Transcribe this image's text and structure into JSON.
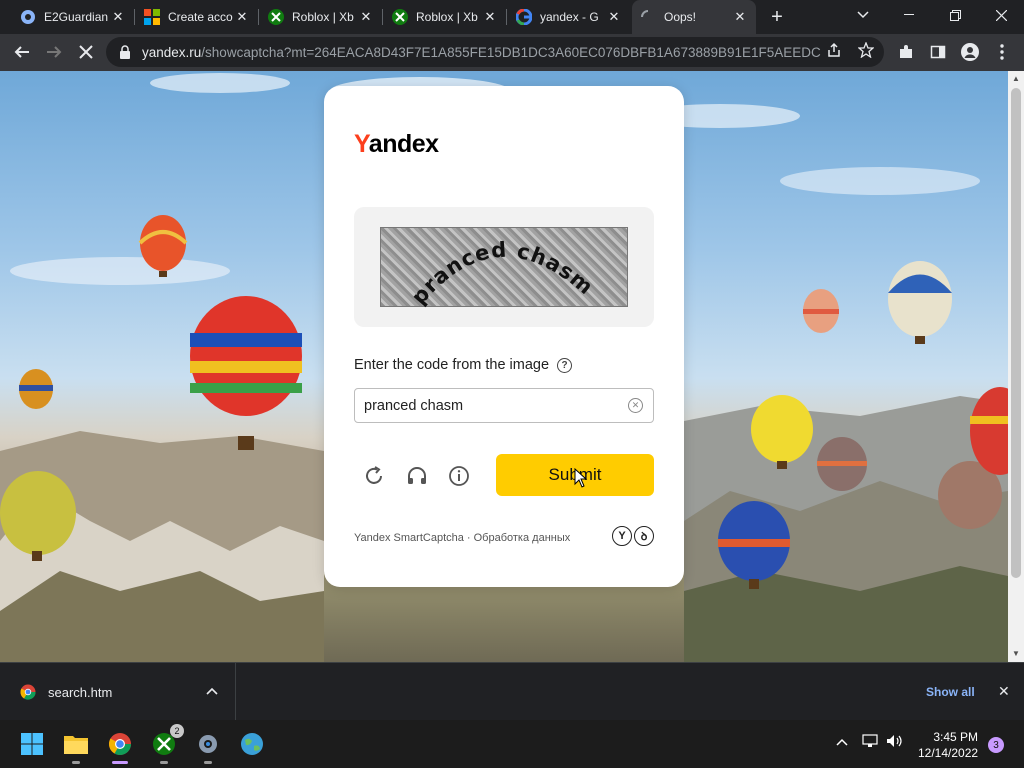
{
  "browser": {
    "tabs": [
      {
        "title": "E2Guardian",
        "favicon": "globe-icon"
      },
      {
        "title": "Create acco",
        "favicon": "microsoft-logo-icon"
      },
      {
        "title": "Roblox | Xb",
        "favicon": "xbox-icon"
      },
      {
        "title": "Roblox | Xb",
        "favicon": "xbox-icon"
      },
      {
        "title": "yandex - G",
        "favicon": "google-icon"
      },
      {
        "title": "Oops!",
        "favicon": "loading-spinner-icon",
        "active": true
      }
    ],
    "url_host": "yandex.ru",
    "url_path": "/showcaptcha?mt=264EACA8D43F7E1A855FE15DB1DC3A60EC076DBFB1A673889B91E1F5AEEDC..."
  },
  "captcha": {
    "logo_first": "Y",
    "logo_rest": "andex",
    "image_text": "pranced chasm",
    "prompt": "Enter the code from the image",
    "help": "?",
    "input_value": "pranced chasm",
    "submit_label": "Submit",
    "footer": "Yandex SmartCaptcha · Обработка данных",
    "footer_logo_1": "Y",
    "footer_logo_2": "ꝺ"
  },
  "downloads": {
    "file_name": "search.htm",
    "show_all": "Show all"
  },
  "taskbar": {
    "xbox_badge": "2",
    "time": "3:45 PM",
    "date": "12/14/2022",
    "notifications": "3"
  },
  "colors": {
    "yandex_red": "#fc3f1d",
    "submit_yellow": "#ffcc00",
    "link_blue": "#8ab4f8"
  }
}
